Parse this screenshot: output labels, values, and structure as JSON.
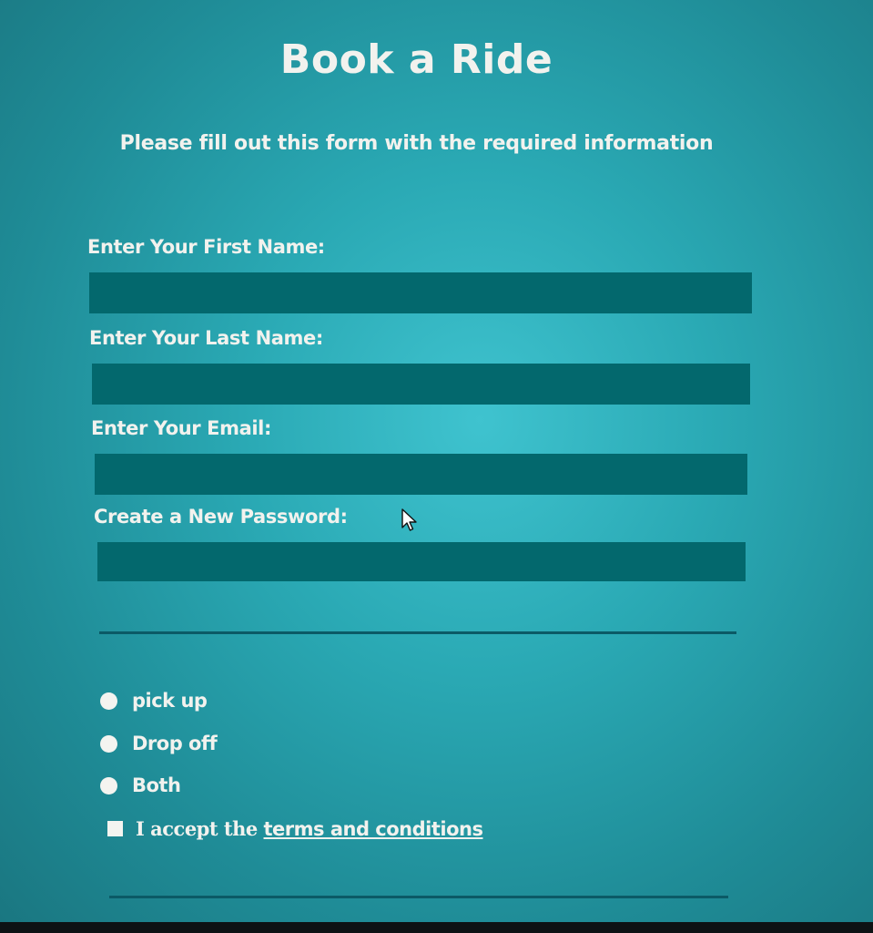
{
  "form": {
    "title": "Book a Ride",
    "subtitle": "Please fill out this form with the required information",
    "fields": [
      {
        "label": "Enter Your First Name:",
        "value": "",
        "placeholder": ""
      },
      {
        "label": "Enter Your Last Name:",
        "value": "",
        "placeholder": ""
      },
      {
        "label": "Enter Your Email:",
        "value": "",
        "placeholder": ""
      },
      {
        "label": "Create a New Password:",
        "value": "",
        "placeholder": ""
      }
    ],
    "ride_options": [
      {
        "label": "pick up"
      },
      {
        "label": "Drop off"
      },
      {
        "label": "Both"
      }
    ],
    "terms": {
      "prefix": "I accept the ",
      "link_text": "terms and conditions"
    }
  },
  "colors": {
    "background": "#2aa9b4",
    "input_fill": "#03686d",
    "divider": "#0b5a66",
    "text": "#f2f2ee"
  },
  "icons": {
    "cursor": "mouse-pointer-icon"
  }
}
